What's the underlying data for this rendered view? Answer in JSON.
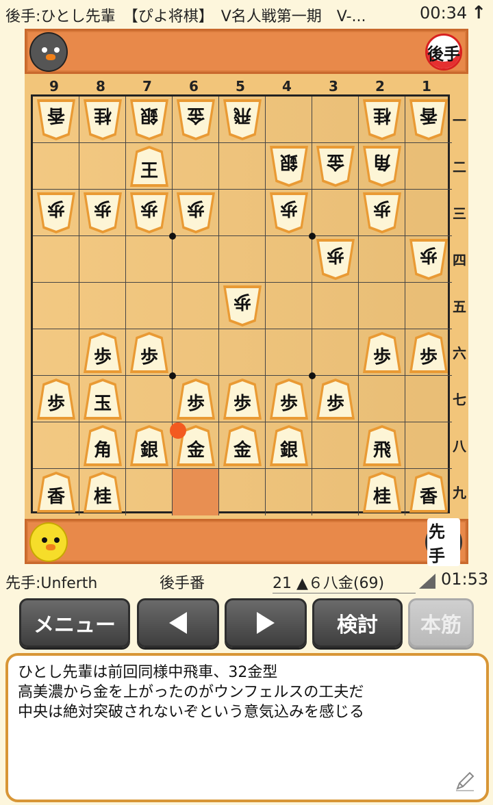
{
  "status_bar": {
    "title": "後手:ひとし先輩　【ぴよ将棋】　V名人戦第一期　V-...",
    "time": "00:34",
    "arrow_icon": "arrow-up-icon"
  },
  "gote": {
    "badge": "後手"
  },
  "sente": {
    "badge": "先手"
  },
  "board": {
    "files": [
      "9",
      "8",
      "7",
      "6",
      "5",
      "4",
      "3",
      "2",
      "1"
    ],
    "ranks": [
      "一",
      "二",
      "三",
      "四",
      "五",
      "六",
      "七",
      "八",
      "九"
    ],
    "highlight_square": "6九",
    "last_move_dot": "6八",
    "pieces": [
      {
        "sq": "9一",
        "k": "香",
        "side": "gote"
      },
      {
        "sq": "8一",
        "k": "桂",
        "side": "gote"
      },
      {
        "sq": "7一",
        "k": "銀",
        "side": "gote"
      },
      {
        "sq": "6一",
        "k": "金",
        "side": "gote"
      },
      {
        "sq": "5一",
        "k": "飛",
        "side": "gote"
      },
      {
        "sq": "2一",
        "k": "桂",
        "side": "gote"
      },
      {
        "sq": "1一",
        "k": "香",
        "side": "gote"
      },
      {
        "sq": "7二",
        "k": "王",
        "side": "sente_upright"
      },
      {
        "sq": "4二",
        "k": "銀",
        "side": "gote"
      },
      {
        "sq": "3二",
        "k": "金",
        "side": "gote"
      },
      {
        "sq": "2二",
        "k": "角",
        "side": "gote"
      },
      {
        "sq": "9三",
        "k": "歩",
        "side": "gote"
      },
      {
        "sq": "8三",
        "k": "歩",
        "side": "gote"
      },
      {
        "sq": "7三",
        "k": "歩",
        "side": "gote"
      },
      {
        "sq": "6三",
        "k": "歩",
        "side": "gote"
      },
      {
        "sq": "4三",
        "k": "歩",
        "side": "gote"
      },
      {
        "sq": "2三",
        "k": "歩",
        "side": "gote"
      },
      {
        "sq": "3四",
        "k": "歩",
        "side": "gote"
      },
      {
        "sq": "1四",
        "k": "歩",
        "side": "gote"
      },
      {
        "sq": "5五",
        "k": "歩",
        "side": "gote"
      },
      {
        "sq": "8六",
        "k": "歩",
        "side": "sente"
      },
      {
        "sq": "7六",
        "k": "歩",
        "side": "sente"
      },
      {
        "sq": "2六",
        "k": "歩",
        "side": "sente"
      },
      {
        "sq": "1六",
        "k": "歩",
        "side": "sente"
      },
      {
        "sq": "9七",
        "k": "歩",
        "side": "sente"
      },
      {
        "sq": "8七",
        "k": "玉",
        "side": "sente"
      },
      {
        "sq": "6七",
        "k": "歩",
        "side": "sente"
      },
      {
        "sq": "5七",
        "k": "歩",
        "side": "sente"
      },
      {
        "sq": "4七",
        "k": "歩",
        "side": "sente"
      },
      {
        "sq": "3七",
        "k": "歩",
        "side": "sente"
      },
      {
        "sq": "8八",
        "k": "角",
        "side": "sente"
      },
      {
        "sq": "7八",
        "k": "銀",
        "side": "sente"
      },
      {
        "sq": "6八",
        "k": "金",
        "side": "sente"
      },
      {
        "sq": "5八",
        "k": "金",
        "side": "sente"
      },
      {
        "sq": "4八",
        "k": "銀",
        "side": "sente"
      },
      {
        "sq": "2八",
        "k": "飛",
        "side": "sente"
      },
      {
        "sq": "9九",
        "k": "香",
        "side": "sente"
      },
      {
        "sq": "8九",
        "k": "桂",
        "side": "sente"
      },
      {
        "sq": "2九",
        "k": "桂",
        "side": "sente"
      },
      {
        "sq": "1九",
        "k": "香",
        "side": "sente"
      }
    ]
  },
  "info": {
    "sente_name": "先手:Unferth",
    "turn": "後手番",
    "move": "21 ▲６八金(69)",
    "clock": "01:53"
  },
  "buttons": {
    "menu": "メニュー",
    "prev_icon": "triangle-left-icon",
    "next_icon": "triangle-right-icon",
    "kento": "検討",
    "honsuji": "本筋"
  },
  "comment": {
    "lines": [
      "ひとし先輩は前回同様中飛車、32金型",
      "高美濃から金を上がったのがウンフェルスの工夫だ",
      "中央は絶対突破されないぞという意気込みを感じる"
    ],
    "edit_icon": "pencil-icon"
  }
}
